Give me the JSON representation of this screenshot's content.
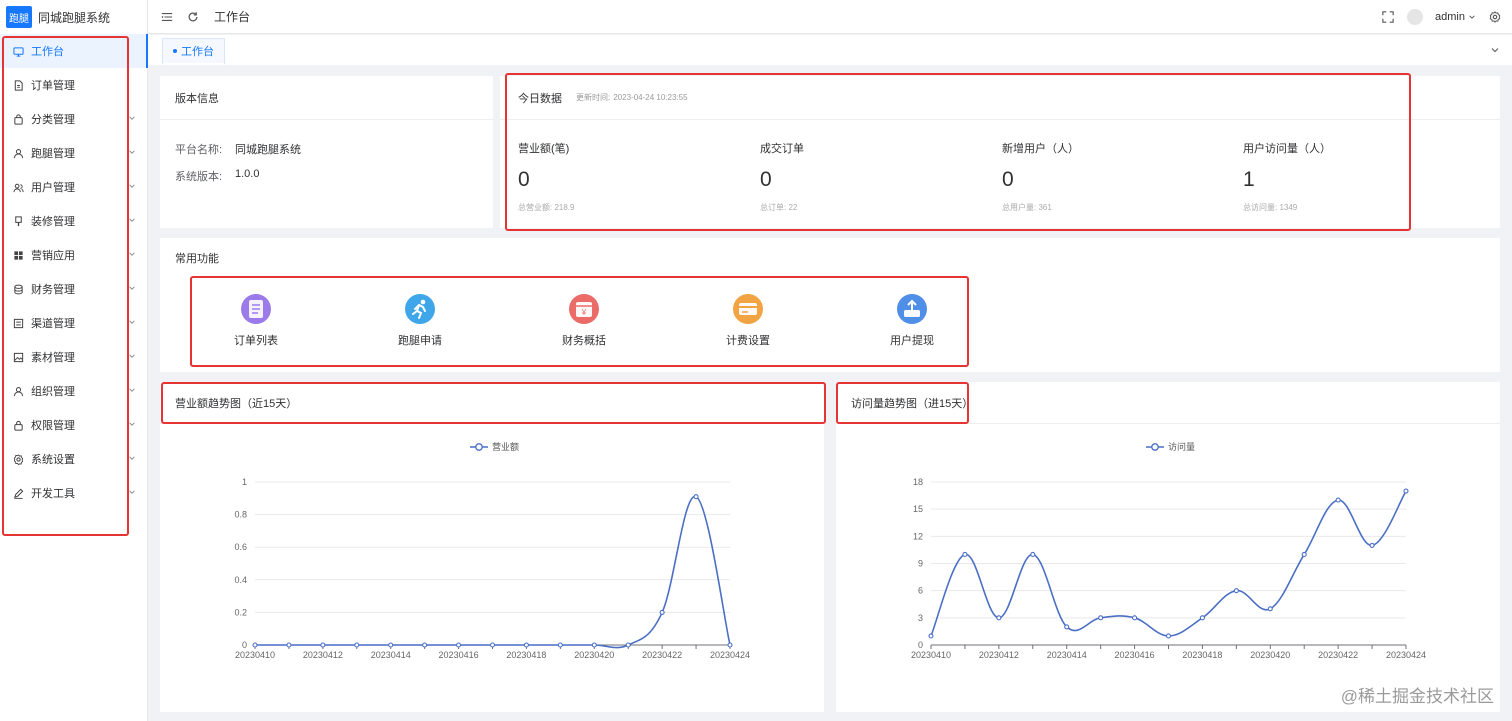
{
  "app": {
    "logo_badge": "跑腿",
    "title": "同城跑腿系统",
    "brand_color": "#1677ff",
    "highlight_color": "#e63333"
  },
  "sidebar": {
    "items": [
      {
        "label": "工作台",
        "icon": "monitor-icon",
        "active": true,
        "has_children": false
      },
      {
        "label": "订单管理",
        "icon": "document-icon",
        "active": false,
        "has_children": false
      },
      {
        "label": "分类管理",
        "icon": "bag-icon",
        "active": false,
        "has_children": true
      },
      {
        "label": "跑腿管理",
        "icon": "user-icon",
        "active": false,
        "has_children": true
      },
      {
        "label": "用户管理",
        "icon": "users-icon",
        "active": false,
        "has_children": true
      },
      {
        "label": "装修管理",
        "icon": "brush-icon",
        "active": false,
        "has_children": true
      },
      {
        "label": "营销应用",
        "icon": "grid-icon",
        "active": false,
        "has_children": true
      },
      {
        "label": "财务管理",
        "icon": "database-icon",
        "active": false,
        "has_children": true
      },
      {
        "label": "渠道管理",
        "icon": "channel-icon",
        "active": false,
        "has_children": true
      },
      {
        "label": "素材管理",
        "icon": "image-icon",
        "active": false,
        "has_children": true
      },
      {
        "label": "组织管理",
        "icon": "person-icon",
        "active": false,
        "has_children": true
      },
      {
        "label": "权限管理",
        "icon": "lock-icon",
        "active": false,
        "has_children": true
      },
      {
        "label": "系统设置",
        "icon": "gear-icon",
        "active": false,
        "has_children": true
      },
      {
        "label": "开发工具",
        "icon": "pen-icon",
        "active": false,
        "has_children": true
      }
    ]
  },
  "topbar": {
    "title": "工作台",
    "user": "admin"
  },
  "tabs": [
    {
      "label": "工作台"
    }
  ],
  "version": {
    "header": "版本信息",
    "platform_label": "平台名称:",
    "platform_value": "同城跑腿系统",
    "version_label": "系统版本:",
    "version_value": "1.0.0"
  },
  "today": {
    "header": "今日数据",
    "updated_label": "更新时间:",
    "updated_time": "2023-04-24 10:23:55",
    "stats": [
      {
        "label": "营业额(笔)",
        "value": "0",
        "total": "总营业额: 218.9"
      },
      {
        "label": "成交订单",
        "value": "0",
        "total": "总订单: 22"
      },
      {
        "label": "新增用户（人）",
        "value": "0",
        "total": "总用户量: 361"
      },
      {
        "label": "用户访问量（人）",
        "value": "1",
        "total": "总访问量: 1349"
      }
    ]
  },
  "functions": {
    "header": "常用功能",
    "items": [
      {
        "label": "订单列表",
        "icon": "clipboard-icon",
        "color": "#9b7bea"
      },
      {
        "label": "跑腿申请",
        "icon": "runner-icon",
        "color": "#3fa6ea"
      },
      {
        "label": "财务概括",
        "icon": "yuan-calendar-icon",
        "color": "#ea6b67"
      },
      {
        "label": "计费设置",
        "icon": "card-icon",
        "color": "#f2a344"
      },
      {
        "label": "用户提现",
        "icon": "upload-icon",
        "color": "#4f8fe8"
      }
    ]
  },
  "revenue_chart": {
    "header": "营业额趋势图（近15天）",
    "legend": "营业额"
  },
  "visits_chart": {
    "header": "访问量趋势图（进15天）",
    "legend": "访问量"
  },
  "chart_data": [
    {
      "type": "line",
      "title": "营业额趋势图（近15天）",
      "x": [
        "20230410",
        "20230411",
        "20230412",
        "20230413",
        "20230414",
        "20230415",
        "20230416",
        "20230417",
        "20230418",
        "20230419",
        "20230420",
        "20230421",
        "20230422",
        "20230423",
        "20230424"
      ],
      "x_tick_labels": [
        "20230410",
        "20230412",
        "20230414",
        "20230416",
        "20230418",
        "20230420",
        "20230422",
        "20230424"
      ],
      "series": [
        {
          "name": "营业额",
          "values": [
            0,
            0,
            0,
            0,
            0,
            0,
            0,
            0,
            0,
            0,
            0,
            0,
            0.2,
            0.91,
            0
          ]
        }
      ],
      "ylim": [
        0,
        1
      ],
      "y_ticks": [
        "0",
        "0.2",
        "0.4",
        "0.6",
        "0.8",
        "1"
      ],
      "legend": "top-center",
      "grid": true,
      "smooth": true,
      "color": "#4a6fc5"
    },
    {
      "type": "line",
      "title": "访问量趋势图（进15天）",
      "x": [
        "20230410",
        "20230411",
        "20230412",
        "20230413",
        "20230414",
        "20230415",
        "20230416",
        "20230417",
        "20230418",
        "20230419",
        "20230420",
        "20230421",
        "20230422",
        "20230423",
        "20230424"
      ],
      "x_tick_labels": [
        "20230410",
        "20230412",
        "20230414",
        "20230416",
        "20230418",
        "20230420",
        "20230422",
        "20230424"
      ],
      "series": [
        {
          "name": "访问量",
          "values": [
            1,
            10,
            3,
            10,
            2,
            3,
            3,
            1,
            3,
            6,
            4,
            10,
            16,
            11,
            17
          ]
        }
      ],
      "ylim": [
        0,
        18
      ],
      "y_ticks": [
        "0",
        "3",
        "6",
        "9",
        "12",
        "15",
        "18"
      ],
      "legend": "top-center",
      "grid": true,
      "smooth": true,
      "color": "#4a6fc5"
    }
  ],
  "watermark": "@稀土掘金技术社区"
}
